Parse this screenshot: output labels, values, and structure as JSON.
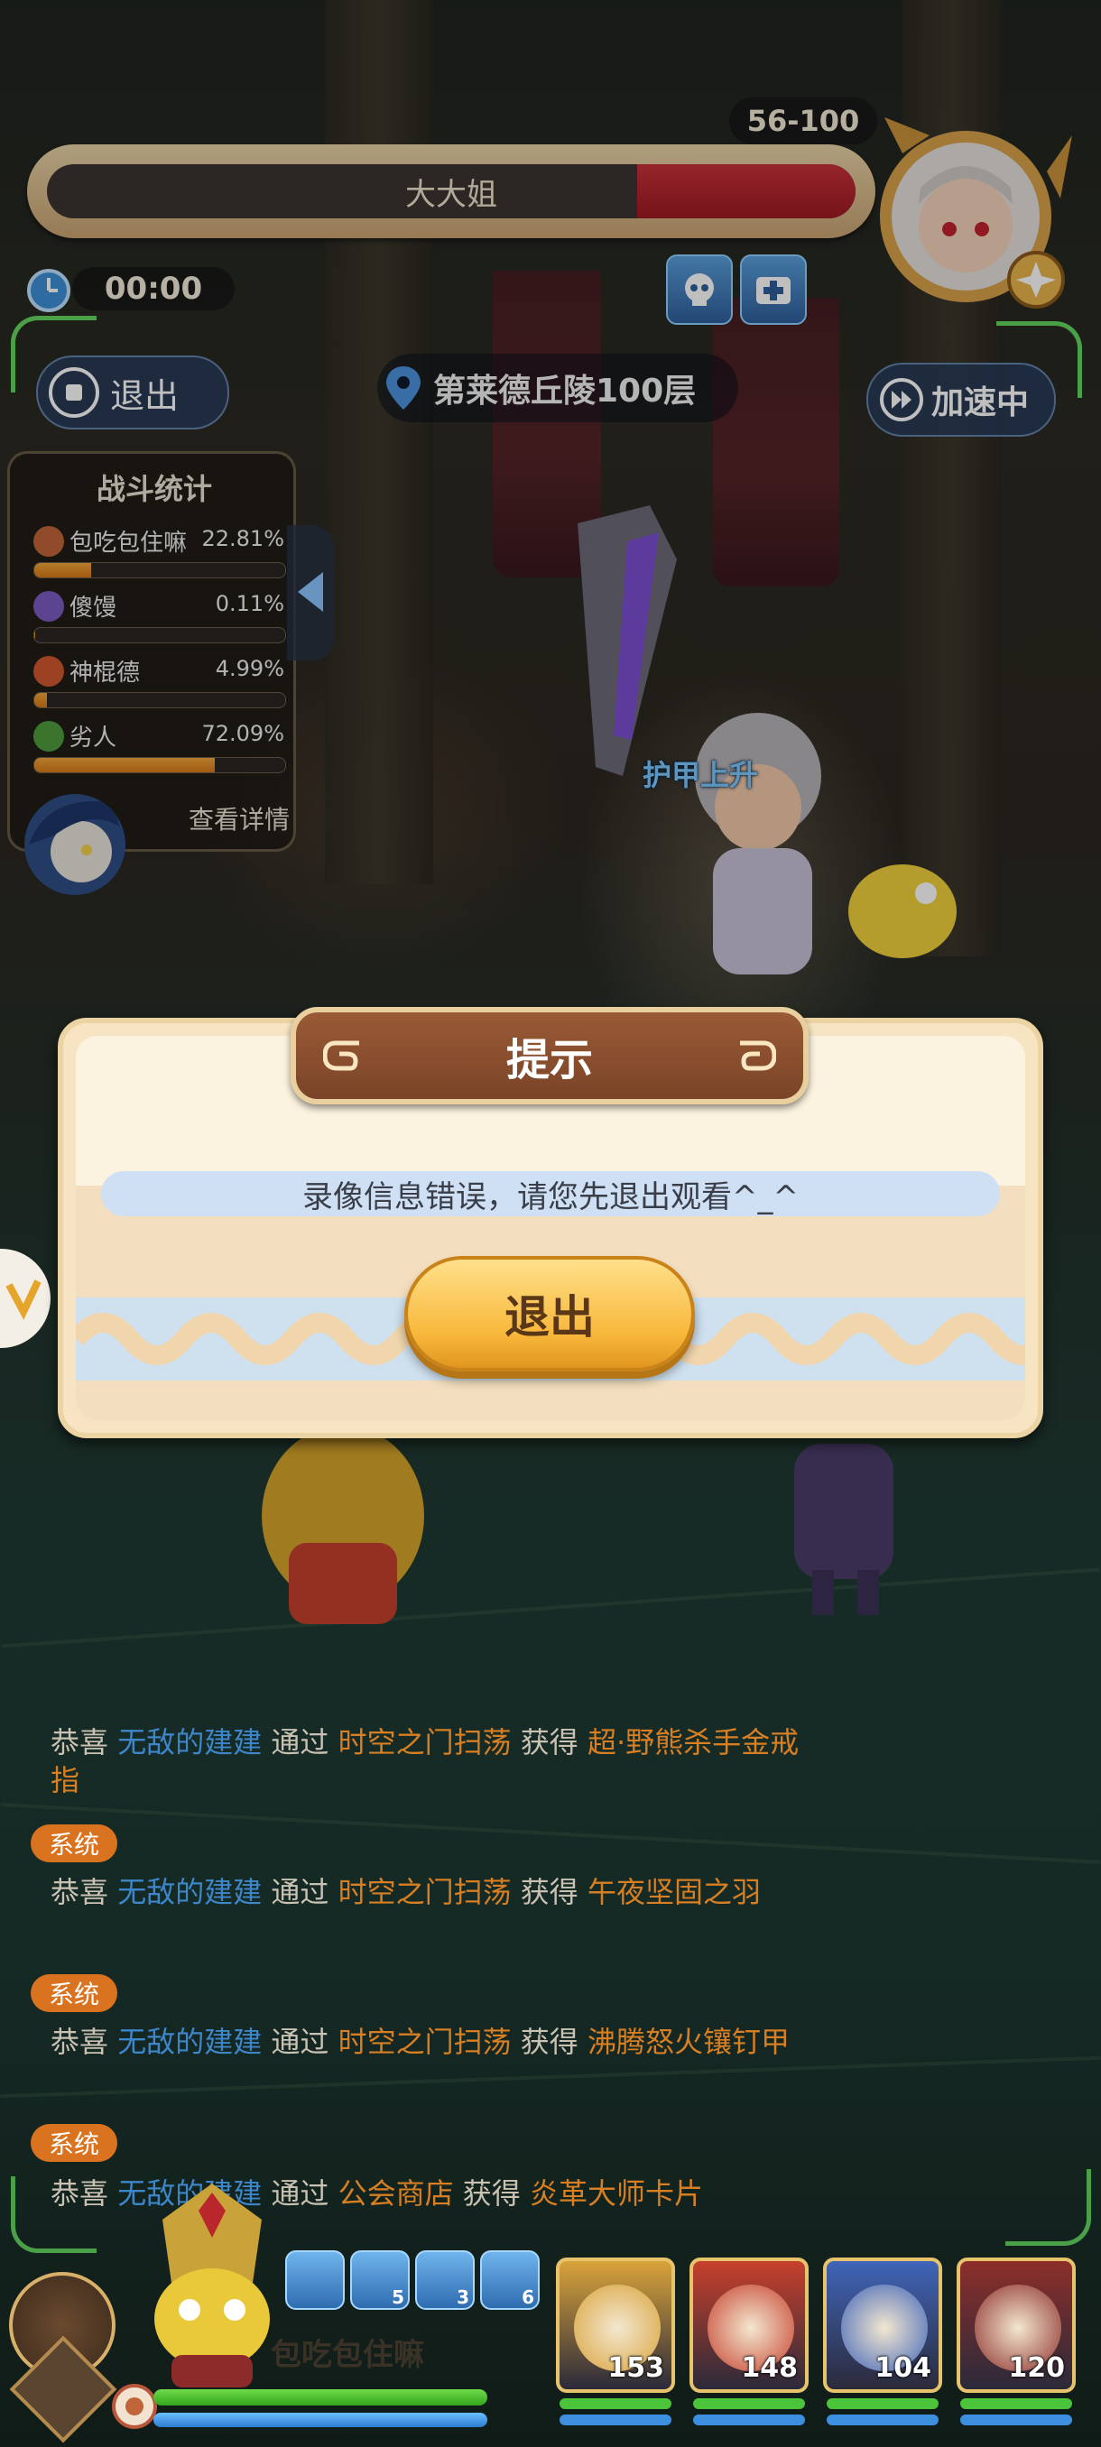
{
  "boss": {
    "name": "大大姐",
    "level_range": "56-100",
    "hp_fraction": 0.27
  },
  "timer": "00:00",
  "buttons": {
    "exit": "退出",
    "speed": "加速中"
  },
  "location": "第莱德丘陵100层",
  "stats": {
    "title": "战斗统计",
    "rows": [
      {
        "name": "包吃包住嘛",
        "percent": "22.81%",
        "value": 0.2281,
        "color": "#c0643a"
      },
      {
        "name": "傻馒",
        "percent": "0.11%",
        "value": 0.0011,
        "color": "#7b5bc2"
      },
      {
        "name": "神棍德",
        "percent": "4.99%",
        "value": 0.0499,
        "color": "#d0572c"
      },
      {
        "name": "劣人",
        "percent": "72.09%",
        "value": 0.7209,
        "color": "#4f9b3c"
      }
    ],
    "more": "查看详情"
  },
  "floating_text": "护甲上升",
  "dialog": {
    "title": "提示",
    "message": "录像信息错误，请您先退出观看^_^",
    "exit": "退出"
  },
  "chat": {
    "lines": [
      {
        "prefix": "恭喜",
        "user": "无敌的建建",
        "via": "通过",
        "source": "时空之门扫荡",
        "got": "获得",
        "item": "超·野熊杀手金戒指"
      },
      {
        "prefix": "恭喜",
        "user": "无敌的建建",
        "via": "通过",
        "source": "时空之门扫荡",
        "got": "获得",
        "item": "午夜坚固之羽"
      },
      {
        "prefix": "恭喜",
        "user": "无敌的建建",
        "via": "通过",
        "source": "时空之门扫荡",
        "got": "获得",
        "item": "沸腾怒火镶钉甲"
      },
      {
        "prefix": "恭喜",
        "user": "无敌的建建",
        "via": "通过",
        "source": "公会商店",
        "got": "获得",
        "item": "炎革大师卡片"
      }
    ],
    "tag": "系统"
  },
  "hud": {
    "name": "包吃包住嘛",
    "skill_counts": [
      "",
      "5",
      "3",
      "6"
    ],
    "cards": [
      {
        "level": "153",
        "color": "#d9a33a"
      },
      {
        "level": "148",
        "color": "#c6402c"
      },
      {
        "level": "104",
        "color": "#3f64b8"
      },
      {
        "level": "120",
        "color": "#8c2e2a"
      }
    ]
  }
}
